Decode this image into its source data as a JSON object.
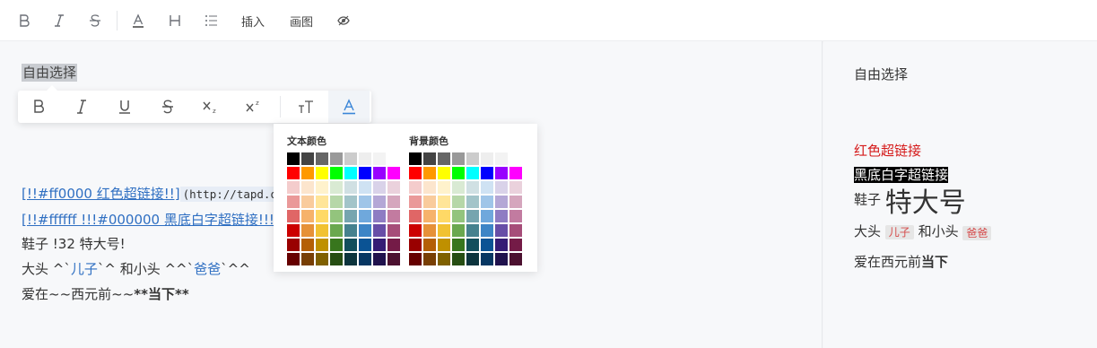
{
  "toolbar": {
    "insert_label": "插入",
    "draw_label": "画图"
  },
  "editor": {
    "line1": "自由选择",
    "line2_link": "[!!#ff0000 红色超链接!!]",
    "line2_code": "(http://tapd.oa",
    "line3_link": "[!!#ffffff !!!#000000 黑底白字超链接!!!!!]",
    "line3_code": "(",
    "line4": "鞋子 !32 特大号!",
    "line5_a": "大头 ^`",
    "line5_b": "儿子",
    "line5_c": "`^ 和小头 ^^`",
    "line5_d": "爸爸",
    "line5_e": "`^^",
    "line6_a": "爱在~~西元前~~",
    "line6_b": "**当下**"
  },
  "palette": {
    "text_title": "文本颜色",
    "bg_title": "背景颜色",
    "colors": [
      "#000000",
      "#444444",
      "#666666",
      "#999999",
      "#cccccc",
      "#eeeeee",
      "#f3f3f3",
      "#ffffff",
      "#ff0000",
      "#ff9900",
      "#ffff00",
      "#00ff00",
      "#00ffff",
      "#0000ff",
      "#9900ff",
      "#ff00ff",
      "#f4cccc",
      "#fce5cd",
      "#fff2cc",
      "#d9ead3",
      "#d0e0e3",
      "#cfe2f3",
      "#d9d2e9",
      "#ead1dc",
      "#ea9999",
      "#f9cb9c",
      "#ffe599",
      "#b6d7a8",
      "#a2c4c9",
      "#9fc5e8",
      "#b4a7d6",
      "#d5a6bd",
      "#e06666",
      "#f6b26b",
      "#ffd966",
      "#93c47d",
      "#76a5af",
      "#6fa8dc",
      "#8e7cc3",
      "#c27ba0",
      "#cc0000",
      "#e69138",
      "#f1c232",
      "#6aa84f",
      "#45818e",
      "#3d85c6",
      "#674ea7",
      "#a64d79",
      "#990000",
      "#b45f06",
      "#bf9000",
      "#38761d",
      "#134f5c",
      "#0b5394",
      "#351c75",
      "#741b47",
      "#660000",
      "#783f04",
      "#7f6000",
      "#274e13",
      "#0c343d",
      "#073763",
      "#20124d",
      "#4c1130"
    ]
  },
  "preview": {
    "line1": "自由选择",
    "red_link": "红色超链接",
    "inv_link": "黑底白字超链接",
    "shoes": "鞋子",
    "xxl": "特大号",
    "bighead": "大头",
    "son": "儿子",
    "and_small": "和小头",
    "dad": "爸爸",
    "love_a": "爱在西元前",
    "love_b": "当下"
  }
}
